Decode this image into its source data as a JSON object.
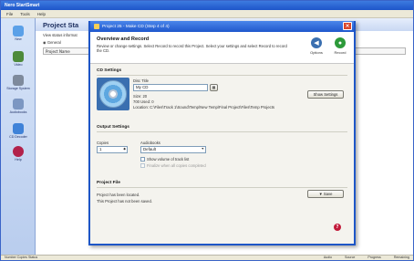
{
  "app": {
    "title": "Nero StartSmart",
    "menu": [
      "File",
      "Tools",
      "Help"
    ],
    "sidebar": [
      {
        "label": "New",
        "icon": "new-icon",
        "color": "#5aa0e8"
      },
      {
        "label": "Video",
        "icon": "video-icon",
        "color": "#4d8a3a"
      },
      {
        "label": "Storage System",
        "icon": "storage-icon",
        "color": "#7e8a9c"
      },
      {
        "label": "Audiobooks",
        "icon": "audiobook-icon",
        "color": "#7c97c2"
      },
      {
        "label": "CD Decoder",
        "icon": "cd-decoder-icon",
        "color": "#3f82d8"
      },
      {
        "label": "Help",
        "icon": "help-icon",
        "color": "#b2224b"
      }
    ],
    "content_title": "Project Sta",
    "content_sub": "View status informat",
    "content_option": "General",
    "content_grid_label": "Project Name",
    "status_left": "Number Copies Status",
    "status_right": [
      "Audio",
      "Source",
      "Progress",
      "Remaining"
    ]
  },
  "dialog": {
    "title": "Project 25 - Make CD (Step 4 of 4)",
    "header_title": "Overview and Record",
    "header_desc": "Review or change settings. Select Record to record this Project. Select your settings and select Record to record the CD.",
    "back_label": "Options",
    "record_label": "Record",
    "cd_section": "CD Settings",
    "disc_title_label": "Disc Title",
    "disc_title_value": "My CD",
    "size_label": "Size: 20",
    "free_label": "700 Used: 0",
    "location_label": "Location: C:\\Files\\Track 1\\Sound\\Temp\\New Temp\\Final Project\\Files\\Temp Projects",
    "show_settings_label": "Show Settings",
    "output_section": "Output Settings",
    "copies_label": "Copies",
    "copies_value": "1",
    "audiobook_label": "Audiobooks",
    "audiobook_value": "Default",
    "check1_label": "Show volume of track list",
    "check2_label": "Finalize when all copies completed",
    "project_section": "Project File",
    "project_saved_label": "Project has been located.",
    "project_status": "This Project has not been saved.",
    "save_label": "Save"
  }
}
